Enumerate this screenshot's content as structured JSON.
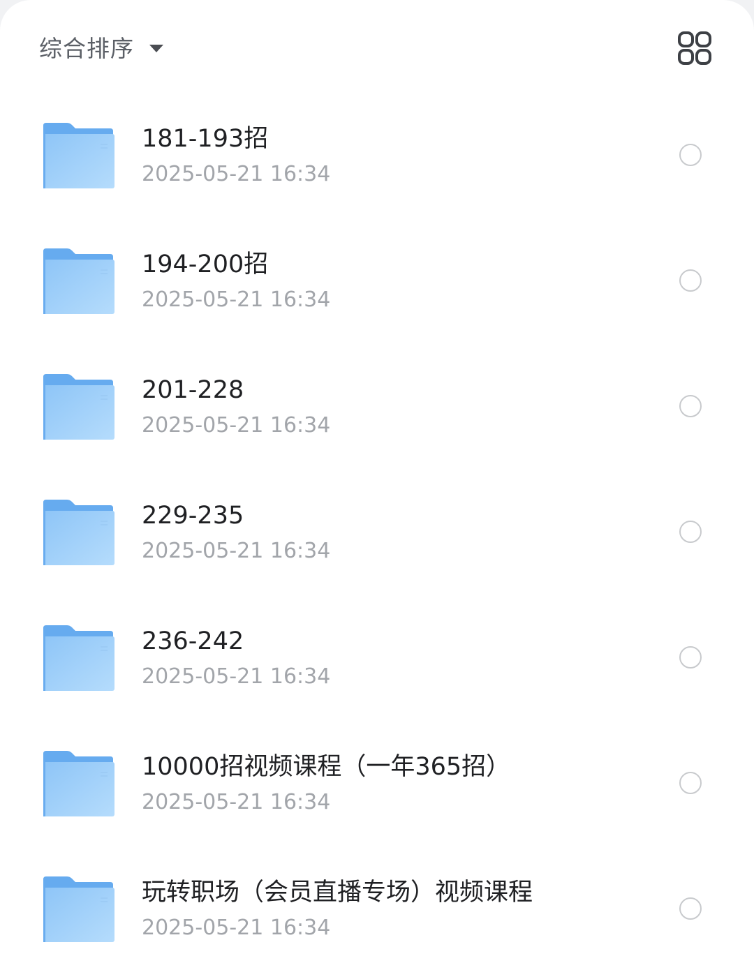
{
  "toolbar": {
    "sort_label": "综合排序",
    "sort_caret_icon": "caret-down-icon",
    "view_toggle_icon": "grid-view-icon"
  },
  "colors": {
    "folder_light": "#a9d5fb",
    "folder_mid": "#7ebcf4",
    "folder_tab": "#63aaf0",
    "title_text": "#1f2023",
    "date_text": "#a2a5aa",
    "radio_border": "#c8cacd"
  },
  "files": [
    {
      "name": "181-193招",
      "date": "2025-05-21 16:34",
      "icon": "folder-icon"
    },
    {
      "name": "194-200招",
      "date": "2025-05-21 16:34",
      "icon": "folder-icon"
    },
    {
      "name": "201-228",
      "date": "2025-05-21 16:34",
      "icon": "folder-icon"
    },
    {
      "name": "229-235",
      "date": "2025-05-21 16:34",
      "icon": "folder-icon"
    },
    {
      "name": "236-242",
      "date": "2025-05-21 16:34",
      "icon": "folder-icon"
    },
    {
      "name": "10000招视频课程（一年365招）",
      "date": "2025-05-21 16:34",
      "icon": "folder-icon"
    },
    {
      "name": "玩转职场（会员直播专场）视频课程",
      "date": "2025-05-21 16:34",
      "icon": "folder-icon"
    }
  ]
}
